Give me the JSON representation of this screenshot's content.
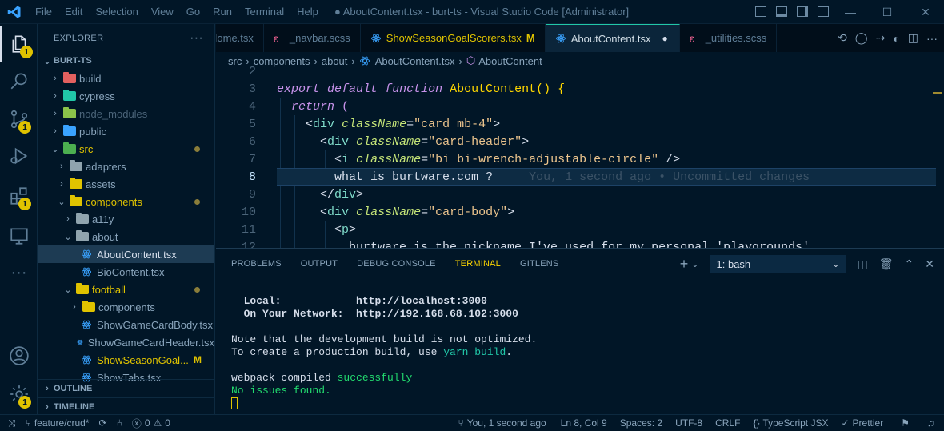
{
  "window": {
    "title": "● AboutContent.tsx - burt-ts - Visual Studio Code [Administrator]",
    "menu": [
      "File",
      "Edit",
      "Selection",
      "View",
      "Go",
      "Run",
      "Terminal",
      "Help"
    ],
    "controls": {
      "minimize": "—",
      "maximize": "☐",
      "close": "✕"
    }
  },
  "activity_bar": {
    "items": [
      {
        "name": "explorer-icon",
        "badge": "1"
      },
      {
        "name": "search-icon",
        "badge": ""
      },
      {
        "name": "source-control-icon",
        "badge": "1"
      },
      {
        "name": "run-debug-icon",
        "badge": ""
      },
      {
        "name": "extensions-icon",
        "badge": "1"
      },
      {
        "name": "remote-explorer-icon",
        "badge": ""
      },
      {
        "name": "more-icon",
        "badge": ""
      }
    ],
    "bottom": [
      "account-icon",
      "settings-gear-icon"
    ],
    "settings_badge": "1"
  },
  "sidebar": {
    "header": "EXPLORER",
    "more": "···",
    "root": "BURT-TS",
    "tree": [
      {
        "label": "build",
        "indent": 0,
        "type": "folder",
        "color": "#e3605f",
        "chev": "›"
      },
      {
        "label": "cypress",
        "indent": 0,
        "type": "folder",
        "color": "#21c7a8",
        "chev": "›"
      },
      {
        "label": "node_modules",
        "indent": 0,
        "type": "folder",
        "color": "#8bc34a",
        "chev": "›",
        "dim": true
      },
      {
        "label": "public",
        "indent": 0,
        "type": "folder",
        "color": "#3aa3ff",
        "chev": "›"
      },
      {
        "label": "src",
        "indent": 0,
        "type": "folder",
        "color": "#4caf50",
        "chev": "⌄",
        "modified": true,
        "text_color": "#e0c300"
      },
      {
        "label": "adapters",
        "indent": 1,
        "type": "folder",
        "color": "#90a4ae",
        "chev": "›"
      },
      {
        "label": "assets",
        "indent": 1,
        "type": "folder",
        "color": "#e0c300",
        "chev": "›"
      },
      {
        "label": "components",
        "indent": 1,
        "type": "folder",
        "color": "#e0c300",
        "chev": "⌄",
        "modified": true,
        "text_color": "#e0c300"
      },
      {
        "label": "a11y",
        "indent": 2,
        "type": "folder",
        "color": "#90a4ae",
        "chev": "›"
      },
      {
        "label": "about",
        "indent": 2,
        "type": "folder",
        "color": "#90a4ae",
        "chev": "⌄"
      },
      {
        "label": "AboutContent.tsx",
        "indent": 3,
        "type": "react",
        "selected": true
      },
      {
        "label": "BioContent.tsx",
        "indent": 3,
        "type": "react"
      },
      {
        "label": "football",
        "indent": 2,
        "type": "folder",
        "color": "#e0c300",
        "chev": "⌄",
        "modified": true,
        "text_color": "#e0c300"
      },
      {
        "label": "components",
        "indent": 3,
        "type": "folder",
        "color": "#e0c300",
        "chev": "›"
      },
      {
        "label": "ShowGameCardBody.tsx",
        "indent": 3,
        "type": "react"
      },
      {
        "label": "ShowGameCardHeader.tsx",
        "indent": 3,
        "type": "react"
      },
      {
        "label": "ShowSeasonGoal...",
        "indent": 3,
        "type": "react",
        "mark": "M",
        "text_color": "#e0c300"
      },
      {
        "label": "ShowTabs.tsx",
        "indent": 3,
        "type": "react"
      }
    ],
    "outline": "OUTLINE",
    "timeline": "TIMELINE"
  },
  "tabs": [
    {
      "label": "Home.tsx",
      "icon": "react-icon",
      "active": false
    },
    {
      "label": "_navbar.scss",
      "icon": "sass-icon",
      "active": false
    },
    {
      "label": "ShowSeasonGoalScorers.tsx",
      "icon": "react-icon",
      "active": false,
      "mark": "M",
      "color": "#e0c300"
    },
    {
      "label": "AboutContent.tsx",
      "icon": "react-icon",
      "active": true,
      "dirty": "●"
    },
    {
      "label": "_utilities.scss",
      "icon": "sass-icon",
      "active": false
    }
  ],
  "breadcrumbs": [
    "src",
    "components",
    "about",
    "AboutContent.tsx",
    "AboutContent"
  ],
  "code": {
    "lines": [
      "2",
      "3",
      "4",
      "5",
      "6",
      "7",
      "8",
      "9",
      "10",
      "11",
      "12"
    ],
    "current_line": "8",
    "blame": "You, 1 second ago • Uncommitted changes",
    "line_12_text": "burtware is the nickname I've used for my personal 'playgrounds'"
  },
  "panel": {
    "tabs": [
      "PROBLEMS",
      "OUTPUT",
      "DEBUG CONSOLE",
      "TERMINAL",
      "GITLENS"
    ],
    "active_tab": "TERMINAL",
    "shell": "1: bash",
    "terminal": {
      "local_label": "Local:",
      "local_url": "http://localhost:3000",
      "network_label": "On Your Network:",
      "network_url": "http://192.168.68.102:3000",
      "note1": "Note that the development build is not optimized.",
      "note2_prefix": "To create a production build, use ",
      "note2_cmd": "yarn build",
      "note2_suffix": ".",
      "compiled_prefix": "webpack compiled ",
      "compiled_status": "successfully",
      "issues": "No issues found."
    }
  },
  "status_bar": {
    "branch": "feature/crud*",
    "errors": "0",
    "warnings": "0",
    "blame": "You, 1 second ago",
    "position": "Ln 8, Col 9",
    "spaces": "Spaces: 2",
    "encoding": "UTF-8",
    "eol": "CRLF",
    "language": "TypeScript JSX",
    "formatter": "Prettier"
  }
}
